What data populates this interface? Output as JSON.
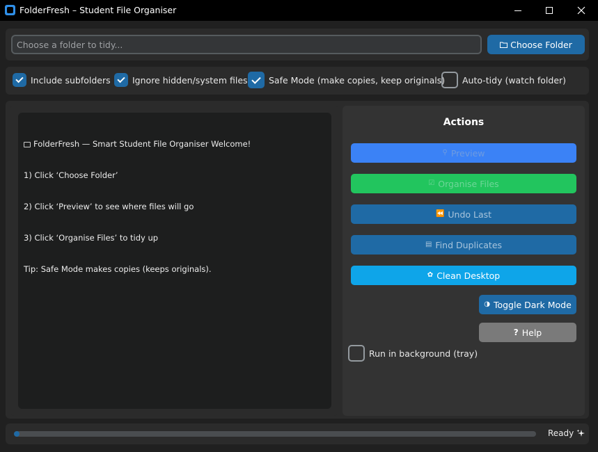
{
  "window": {
    "title": "FolderFresh – Student File Organiser"
  },
  "top": {
    "placeholder": "Choose a folder to tidy...",
    "choose_label": "Choose Folder"
  },
  "options": [
    {
      "label": "Include subfolders",
      "checked": true
    },
    {
      "label": "Ignore hidden/system files",
      "checked": true
    },
    {
      "label": "Safe Mode (make copies, keep originals)",
      "checked": true
    },
    {
      "label": "Auto-tidy (watch folder)",
      "checked": false
    }
  ],
  "log": {
    "lines": [
      "FolderFresh — Smart Student File Organiser Welcome!",
      "1) Click ‘Choose Folder’",
      "2) Click ‘Preview’ to see where files will go",
      "3) Click ‘Organise Files’ to tidy up",
      "Tip: Safe Mode makes copies (keeps originals)."
    ]
  },
  "actions": {
    "title": "Actions",
    "preview": "Preview",
    "organise": "Organise Files",
    "undo": "Undo Last",
    "duplicates": "Find Duplicates",
    "clean": "Clean Desktop",
    "dark_mode": "Toggle Dark Mode",
    "help": "Help",
    "run_background": "Run in background (tray)",
    "run_background_checked": false
  },
  "status": {
    "text": "Ready",
    "progress_fraction": 0.01
  },
  "colors": {
    "accent": "#1f6aa5",
    "preview": "#3b82f6",
    "organise": "#22c55e",
    "clean": "#0ea5e9",
    "help": "#7a7a7a"
  }
}
